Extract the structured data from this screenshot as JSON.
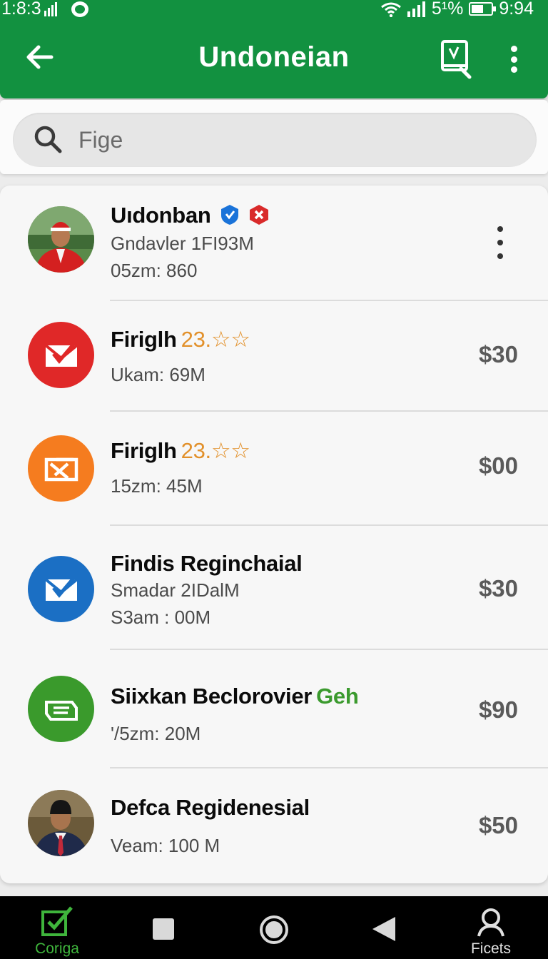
{
  "status_bar": {
    "time_left": "1:8:3",
    "battery_percent": "5¹%",
    "time_right": "9:94"
  },
  "app_bar": {
    "title": "Undoneian",
    "back_icon": "arrow-left-icon",
    "doc_icon": "document-search-icon",
    "more_icon": "more-vertical-icon"
  },
  "search": {
    "placeholder": "Fige",
    "icon": "search-icon"
  },
  "items": [
    {
      "title": "Uıdonban",
      "badges": [
        "verified-shield-icon",
        "red-hex-badge-icon"
      ],
      "subtitle": "Gndavler  1FI93M",
      "meta": "05zm: 860",
      "price": "",
      "avatar": "person-photo-red-jacket"
    },
    {
      "title": "Firiglh",
      "rating": "23.☆☆",
      "subtitle": "Ukam: 69M",
      "price": "$30",
      "icon_color": "#e02828",
      "icon": "mail-check-icon"
    },
    {
      "title": "Firiglh",
      "rating": "23.☆☆",
      "subtitle": "15zm: 45M",
      "price": "$00",
      "icon_color": "#f57c1f",
      "icon": "box-cross-icon"
    },
    {
      "title": "Findis Reginchaial",
      "subtitle": "Smadar 2IDalM",
      "meta": "S3am : 00M",
      "price": "$30",
      "icon_color": "#1b6fc4",
      "icon": "mail-check-icon"
    },
    {
      "title": "Siixkan Beclorovier",
      "tag": "Geh",
      "subtitle": "'/5zm: 20M",
      "price": "$90",
      "icon_color": "#3a9a2c",
      "icon": "ticket-icon"
    },
    {
      "title": "Defca Regidenesial",
      "subtitle": "Veam: 100 M",
      "price": "$50",
      "avatar": "person-photo-suit"
    }
  ],
  "bottom_nav": {
    "left_label": "Coriga",
    "right_label": "Ficets",
    "accent_color": "#3fb53c"
  }
}
